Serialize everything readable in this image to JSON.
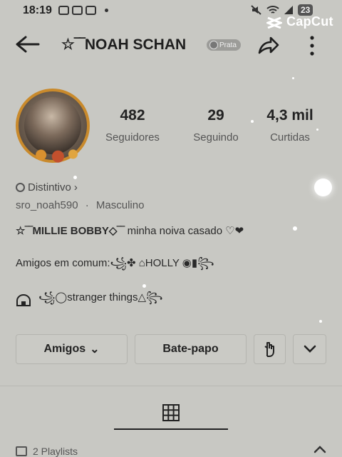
{
  "status_bar": {
    "time": "18:19",
    "battery": "23"
  },
  "watermark": {
    "label": "CapCut"
  },
  "header": {
    "title": "☆‾‾NOAH SCHAN",
    "rank_label": "Prata"
  },
  "profile": {
    "stats": [
      {
        "value": "482",
        "label": "Seguidores"
      },
      {
        "value": "29",
        "label": "Seguindo"
      },
      {
        "value": "4,3 mil",
        "label": "Curtidas"
      }
    ],
    "badge_label": "Distintivo",
    "badge_chevron": "›",
    "username": "sro_noah590",
    "separator": "·",
    "gender": "Masculino",
    "bio_line1_name": "☆‾‾MILLIE BOBBY◇‾‾",
    "bio_line1_rest": " minha noiva casado ♡❤",
    "bio_line2": "Amigos em comum:꧁✤ ⌂HOLLY ◉▮꧂",
    "link_text": "꧁◯stranger things△꧂"
  },
  "actions": {
    "friends_label": "Amigos",
    "friends_chevron": "⌄",
    "chat_label": "Bate-papo"
  },
  "tabs": {
    "playlists_label": "2 Playlists"
  }
}
